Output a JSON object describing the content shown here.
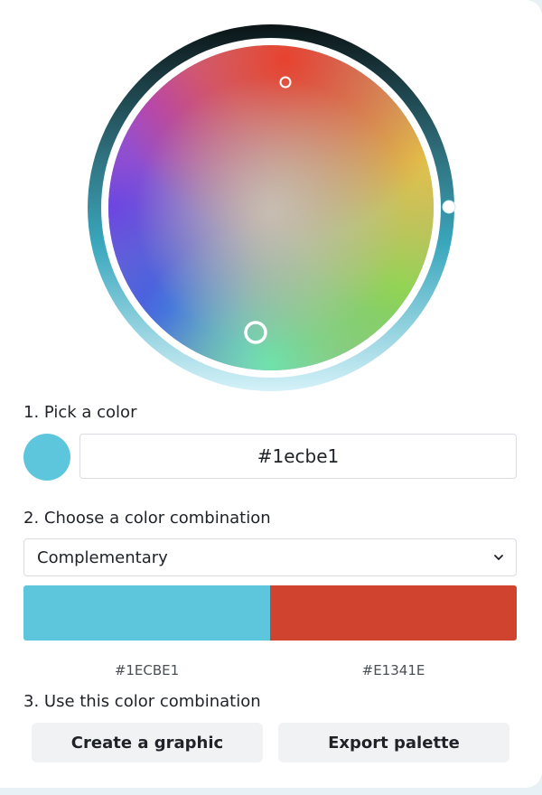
{
  "color_wheel": {
    "colors": {
      "brightness_ring_dark": "#0b1416",
      "brightness_ring_mid": "#3aa7bd",
      "brightness_ring_light": "#d4f1f8",
      "hue_red": "#e8422f",
      "hue_green": "#7ed957",
      "hue_blue": "#3b5de6",
      "hue_purple": "#7b3fe0"
    }
  },
  "step1": {
    "label": "1. Pick a color",
    "swatch_color": "#5ec6dc",
    "hex_value": "#1ecbe1"
  },
  "step2": {
    "label": "2. Choose a color combination",
    "combination": "Complementary",
    "palette": [
      {
        "color": "#5ec6dc",
        "hex_label": "#1ECBE1"
      },
      {
        "color": "#d0442f",
        "hex_label": "#E1341E"
      }
    ]
  },
  "step3": {
    "label": "3. Use this color combination",
    "create_button": "Create a graphic",
    "export_button": "Export palette"
  }
}
